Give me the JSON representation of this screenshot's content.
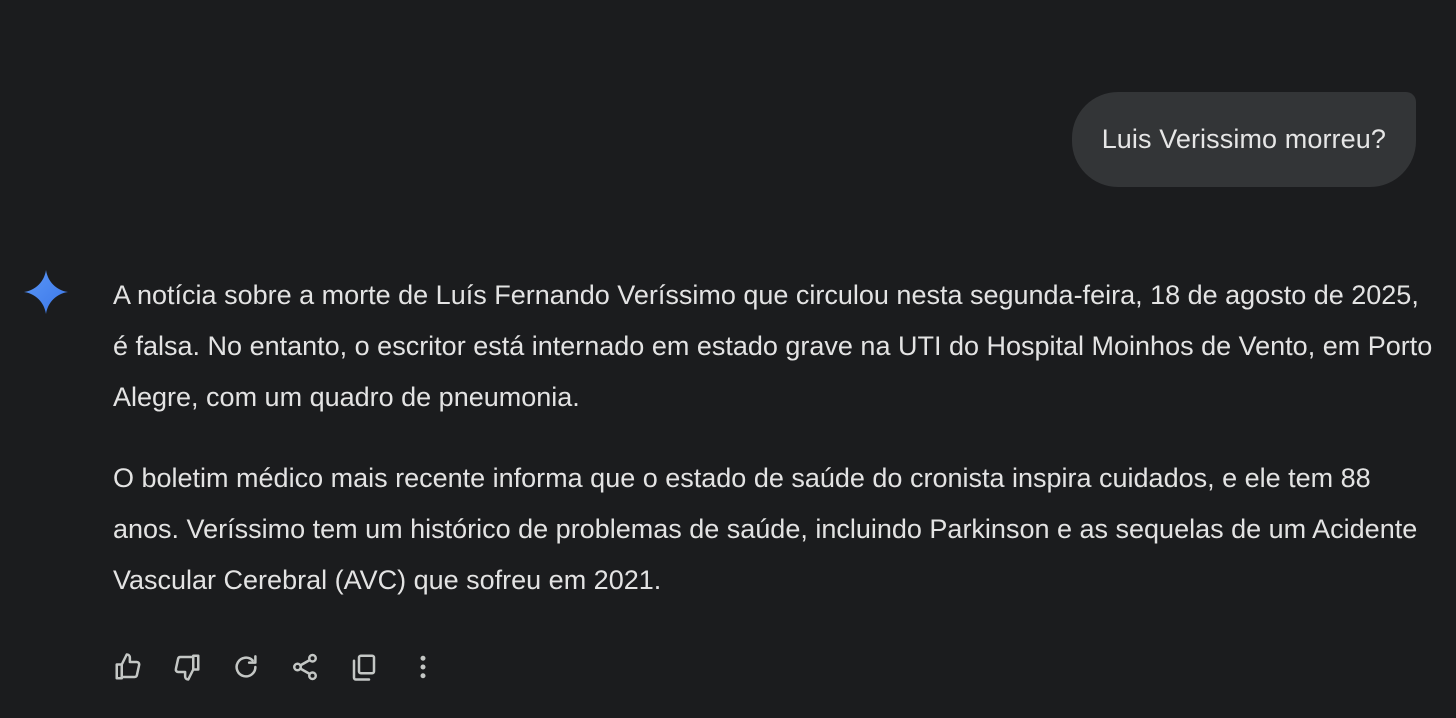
{
  "user_message": {
    "text": "Luis Verissimo morreu?"
  },
  "response": {
    "icon": "gemini-sparkle-icon",
    "paragraphs": [
      "A notícia sobre a morte de Luís Fernando Veríssimo que circulou nesta segunda-feira, 18 de agosto de 2025, é falsa. No entanto, o escritor está internado em estado grave na UTI do Hospital Moinhos de Vento, em Porto Alegre, com um quadro de pneumonia.",
      "O boletim médico mais recente informa que o estado de saúde do cronista inspira cuidados, e ele tem 88 anos. Veríssimo tem um histórico de problemas de saúde, incluindo Parkinson e as sequelas de um Acidente Vascular Cerebral (AVC) que sofreu em 2021."
    ]
  },
  "actions": [
    {
      "name": "thumbs-up-icon"
    },
    {
      "name": "thumbs-down-icon"
    },
    {
      "name": "regenerate-icon"
    },
    {
      "name": "share-icon"
    },
    {
      "name": "copy-icon"
    },
    {
      "name": "more-vert-icon"
    }
  ],
  "colors": {
    "background": "#1b1c1e",
    "bubble": "#333537",
    "text": "#e3e3e3",
    "icon": "#c4c7c5",
    "sparkle": "#4c8df6"
  }
}
